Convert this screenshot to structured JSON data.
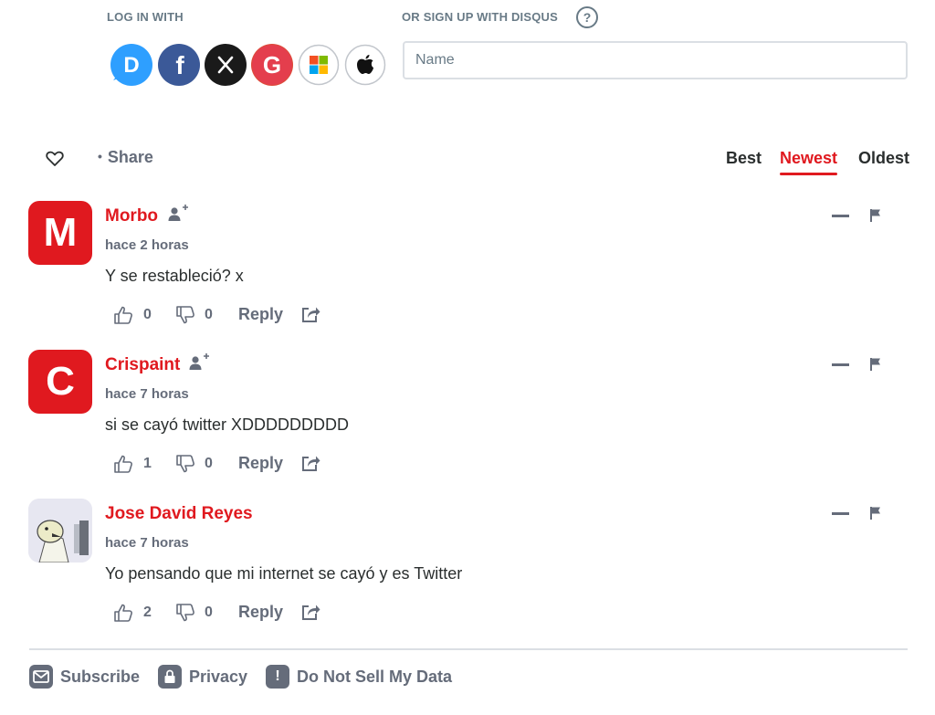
{
  "login": {
    "login_label": "LOG IN WITH",
    "signup_label": "OR SIGN UP WITH DISQUS",
    "help_label": "?",
    "name_placeholder": "Name",
    "providers": [
      {
        "name": "disqus-icon",
        "color": "#2e9fff",
        "letter": "D"
      },
      {
        "name": "facebook-icon",
        "color": "#3b5998",
        "letter": "f"
      },
      {
        "name": "x-icon",
        "color": "#1a1a1a"
      },
      {
        "name": "google-icon",
        "color": "#dd4b39",
        "letter": "G"
      },
      {
        "name": "microsoft-icon",
        "color": "#ffffff"
      },
      {
        "name": "apple-icon",
        "color": "#ffffff"
      }
    ]
  },
  "toolbar": {
    "share_label": "Share",
    "sort_tabs": [
      "Best",
      "Newest",
      "Oldest"
    ],
    "active_sort": "Newest",
    "accent_color": "#e0191f"
  },
  "comments": [
    {
      "initial": "M",
      "author": "Morbo",
      "time": "hace 2 horas",
      "text": "Y se restableció? x",
      "upvotes": "0",
      "downvotes": "0",
      "reply_label": "Reply"
    },
    {
      "initial": "C",
      "author": "Crispaint",
      "time": "hace 7 horas",
      "text": "si se cayó twitter XDDDDDDDDD",
      "upvotes": "1",
      "downvotes": "0",
      "reply_label": "Reply"
    },
    {
      "initial": "",
      "author": "Jose David Reyes",
      "time": "hace 7 horas",
      "text": "Yo pensando que mi internet se cayó y es Twitter",
      "upvotes": "2",
      "downvotes": "0",
      "reply_label": "Reply"
    }
  ],
  "footer": {
    "subscribe_label": "Subscribe",
    "privacy_label": "Privacy",
    "do_not_sell_label": "Do Not Sell My Data"
  }
}
